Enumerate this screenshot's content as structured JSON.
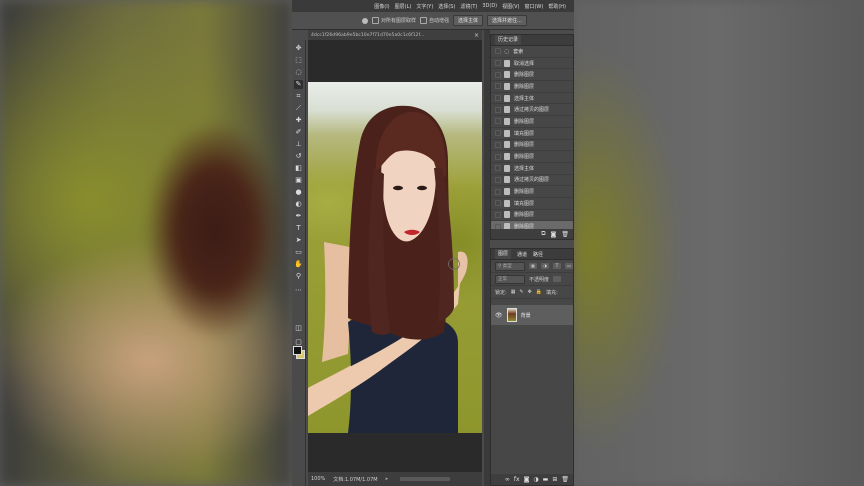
{
  "menubar": {
    "items": [
      "图像(I)",
      "图层(L)",
      "文字(Y)",
      "选择(S)",
      "滤镜(T)",
      "3D(D)",
      "视图(V)",
      "窗口(W)",
      "帮助(H)"
    ]
  },
  "options": {
    "sample_all_layers": "对所有图层取样",
    "auto_enhance": "自动增强",
    "select_subject": "选择主体",
    "select_and_mask": "选择并遮住..."
  },
  "document": {
    "tab_title": "4dcc1f26d96ab9e5bc10e7f71d70e5a0c1c6f12f...",
    "zoom": "100%",
    "doc_size": "文档:1.07M/1.07M"
  },
  "history": {
    "tab_label": "历史记录",
    "items": [
      "套索",
      "取消选择",
      "删除图层",
      "删除图层",
      "选择主体",
      "通过拷贝的图层",
      "删除图层",
      "填充图层",
      "删除图层",
      "删除图层",
      "选择主体",
      "通过拷贝的图层",
      "删除图层",
      "填充图层",
      "删除图层",
      "删除图层"
    ],
    "selected_index": 15
  },
  "layers": {
    "tabs": [
      "图层",
      "通道",
      "路径"
    ],
    "filter_placeholder": "类型",
    "blend_mode": "正常",
    "opacity": "不透明度",
    "lock_label": "锁定:",
    "fill_label": "填充:",
    "background_layer": "背景"
  },
  "icons": {
    "tools": [
      "move-icon",
      "marquee-icon",
      "lasso-icon",
      "quick-select-icon",
      "crop-icon",
      "eyedropper-icon",
      "healing-brush-icon",
      "brush-icon",
      "clone-stamp-icon",
      "history-brush-icon",
      "eraser-icon",
      "gradient-icon",
      "blur-icon",
      "dodge-icon",
      "pen-icon",
      "type-icon",
      "path-select-icon",
      "rectangle-icon",
      "hand-icon",
      "zoom-icon"
    ]
  },
  "colors": {
    "foreground": "#111111",
    "background": "#d8c86a",
    "app_bg": "#4b4b4b"
  }
}
